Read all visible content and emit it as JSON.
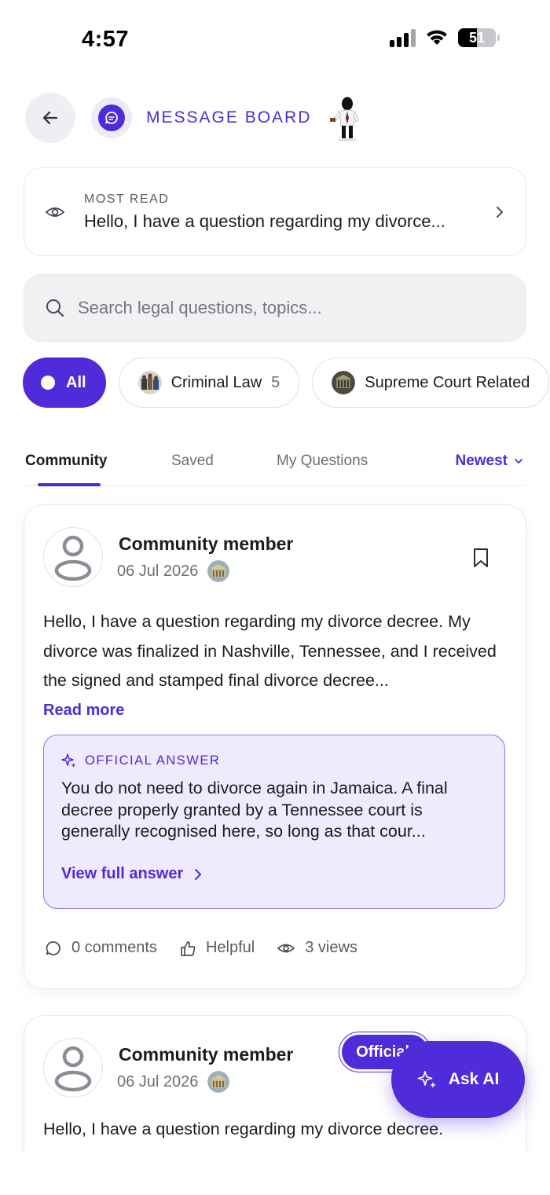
{
  "status_bar": {
    "time": "4:57",
    "battery": "51"
  },
  "header": {
    "title": "MESSAGE BOARD"
  },
  "most_read": {
    "label": "MOST READ",
    "title": "Hello, I have a question regarding my divorce..."
  },
  "search": {
    "placeholder": "Search legal questions, topics..."
  },
  "chips": [
    {
      "label": "All",
      "active": true
    },
    {
      "label": "Criminal Law",
      "count": "5"
    },
    {
      "label": "Supreme Court Related"
    }
  ],
  "tabs": [
    {
      "label": "Community",
      "active": true
    },
    {
      "label": "Saved"
    },
    {
      "label": "My Questions"
    }
  ],
  "sort": {
    "label": "Newest"
  },
  "posts": [
    {
      "author": "Community member",
      "date": "06 Jul 2026",
      "body": "Hello, I have a question regarding my divorce decree. My divorce was finalized in Nashville, Tennessee, and I received the signed and stamped final divorce decree...",
      "read_more": "Read more",
      "answer": {
        "label": "OFFICIAL ANSWER",
        "text": "You do not need to divorce again in Jamaica. A final decree properly granted by a Tennessee court is generally recognised here, so long as that cour...",
        "link": "View full answer"
      },
      "stats": {
        "comments": "0 comments",
        "helpful": "Helpful",
        "views": "3 views"
      }
    },
    {
      "author": "Community member",
      "date": "06 Jul 2026",
      "badge": "Official",
      "body": "Hello, I have a question regarding my divorce decree."
    }
  ],
  "fab": {
    "label": "Ask AI"
  },
  "colors": {
    "accent": "#4f2bd9",
    "answer_bg": "#efeafd"
  }
}
